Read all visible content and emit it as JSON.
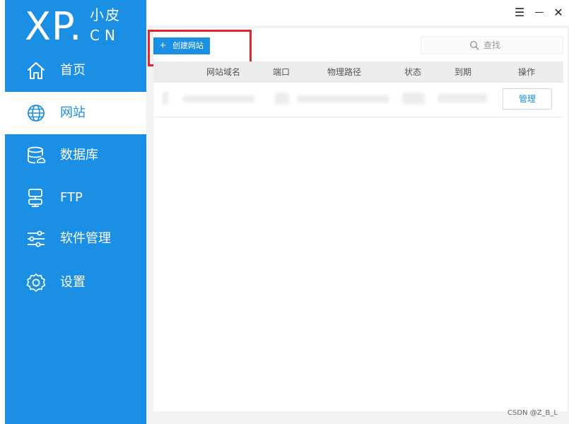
{
  "logo": {
    "brand": "XP.",
    "cn_line1": "小皮",
    "cn_line2": "CN"
  },
  "sidebar": {
    "items": [
      {
        "label": "首页",
        "icon": "home-icon"
      },
      {
        "label": "网站",
        "icon": "globe-icon",
        "active": true
      },
      {
        "label": "数据库",
        "icon": "database-icon"
      },
      {
        "label": "FTP",
        "icon": "server-icon"
      },
      {
        "label": "软件管理",
        "icon": "sliders-icon"
      },
      {
        "label": "设置",
        "icon": "gear-icon"
      }
    ]
  },
  "window_controls": {
    "menu": "☰",
    "minimize": "—",
    "close": "✕"
  },
  "toolbar": {
    "create_label": "创建网站",
    "create_icon": "+"
  },
  "search": {
    "placeholder": "查找"
  },
  "table": {
    "headers": [
      "网站域名",
      "端口",
      "物理路径",
      "状态",
      "到期",
      "操作"
    ],
    "rows": [
      {
        "action_label": "管理"
      }
    ]
  },
  "watermark": "CSDN @Z_B_L",
  "colors": {
    "sidebar": "#1a8fe3",
    "highlight": "#e9232a",
    "background": "#f2f2f2"
  }
}
